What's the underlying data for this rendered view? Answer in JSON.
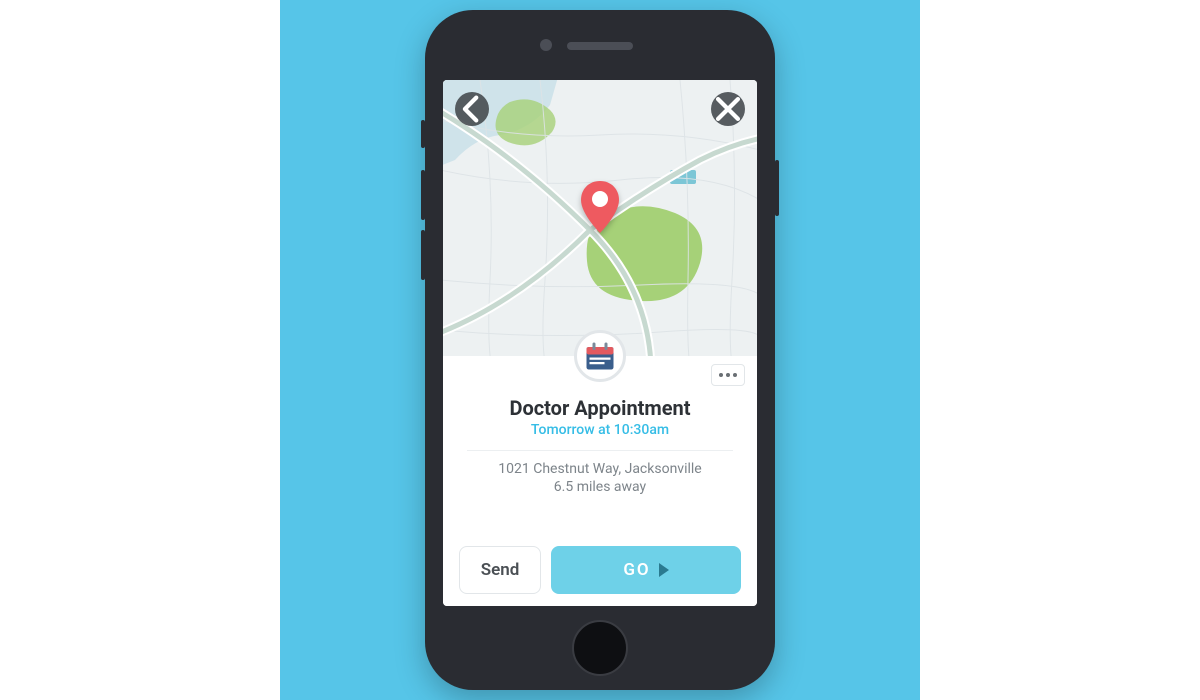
{
  "event": {
    "title": "Doctor Appointment",
    "time": "Tomorrow at 10:30am",
    "address": "1021 Chestnut Way, Jacksonville",
    "distance": "6.5 miles away"
  },
  "actions": {
    "send_label": "Send",
    "go_label": "GO"
  },
  "colors": {
    "accent": "#36bde6",
    "pin": "#ee5a60"
  }
}
